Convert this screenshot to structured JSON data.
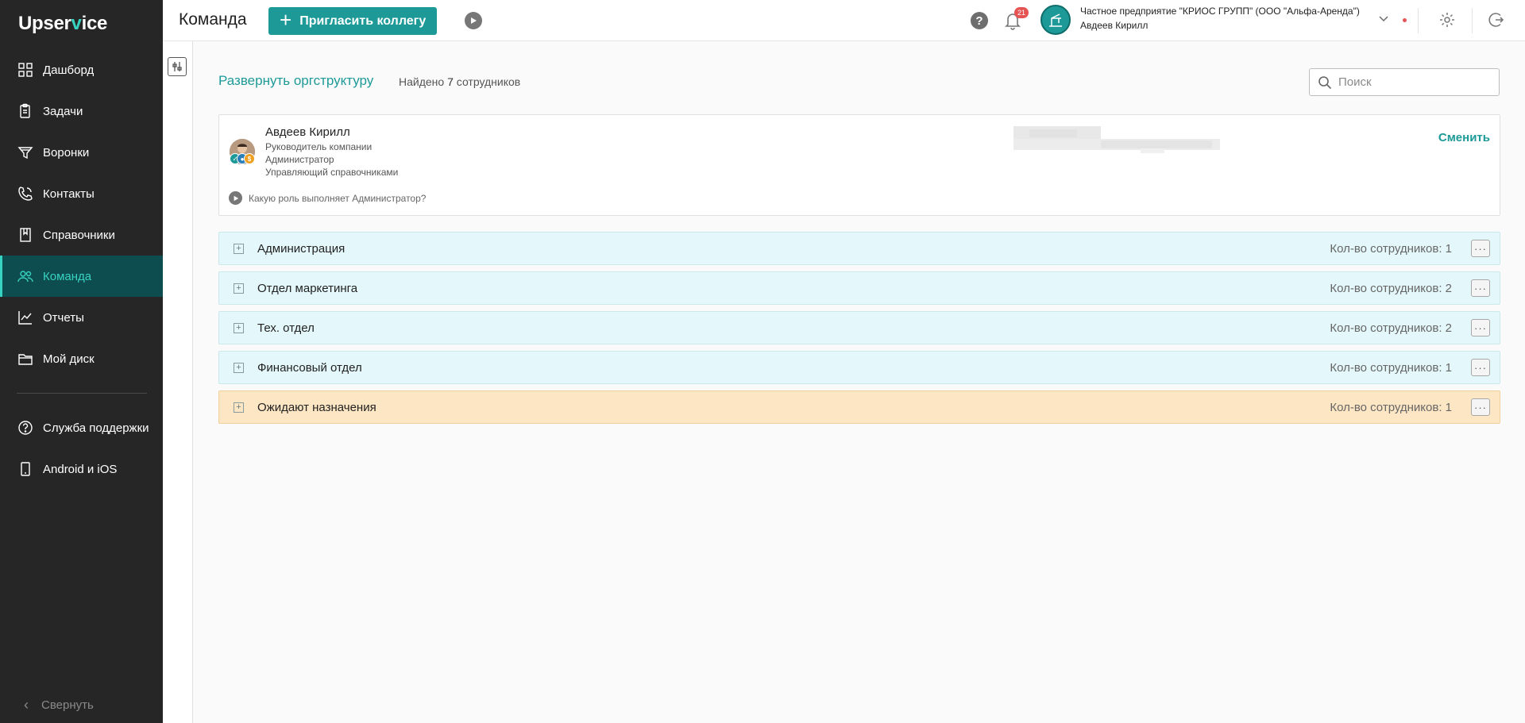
{
  "sidebar": {
    "logo_pre": "Upser",
    "logo_v": "v",
    "logo_post": "ice",
    "items": [
      {
        "label": "Дашборд",
        "icon": "grid-icon"
      },
      {
        "label": "Задачи",
        "icon": "clipboard-icon"
      },
      {
        "label": "Воронки",
        "icon": "funnel-icon"
      },
      {
        "label": "Контакты",
        "icon": "phone-icon"
      },
      {
        "label": "Справочники",
        "icon": "book-icon"
      },
      {
        "label": "Команда",
        "icon": "team-icon",
        "active": true
      },
      {
        "label": "Отчеты",
        "icon": "chart-icon"
      },
      {
        "label": "Мой диск",
        "icon": "folder-icon"
      }
    ],
    "bottom_items": [
      {
        "label": "Служба поддержки",
        "icon": "help-circle-icon"
      },
      {
        "label": "Android и iOS",
        "icon": "phone-device-icon"
      }
    ],
    "collapse_label": "Свернуть"
  },
  "header": {
    "title": "Команда",
    "invite_label": "Пригласить коллегу",
    "notifications_count": "21",
    "help_label": "?",
    "company": "Частное предприятие \"КРИОС ГРУПП\" (ООО \"Альфа-Аренда\")",
    "user": "Авдеев Кирилл"
  },
  "toolbar": {
    "expand_label": "Развернуть оргструктуру",
    "found_prefix": "Найдено",
    "found_count": "7",
    "found_suffix": "сотрудников",
    "search_placeholder": "Поиск"
  },
  "head": {
    "name": "Авдеев Кирилл",
    "roles": [
      "Руководитель компании",
      "Администратор",
      "Управляющий справочниками"
    ],
    "change_label": "Сменить",
    "question": "Какую роль выполняет Администратор?"
  },
  "departments": [
    {
      "name": "Администрация",
      "count_label": "Кол-во сотрудников: 1",
      "type": "normal"
    },
    {
      "name": "Отдел маркетинга",
      "count_label": "Кол-во сотрудников: 2",
      "type": "normal"
    },
    {
      "name": "Тех. отдел",
      "count_label": "Кол-во сотрудников: 2",
      "type": "normal"
    },
    {
      "name": "Финансовый отдел",
      "count_label": "Кол-во сотрудников: 1",
      "type": "normal"
    },
    {
      "name": "Ожидают назначения",
      "count_label": "Кол-во сотрудников: 1",
      "type": "pending"
    }
  ],
  "colors": {
    "accent": "#1d9a98",
    "sidebar_bg": "#262626",
    "active_bg": "#0e4d4f",
    "dept_bg": "#e4f8fb",
    "pending_bg": "#fde6c4"
  }
}
